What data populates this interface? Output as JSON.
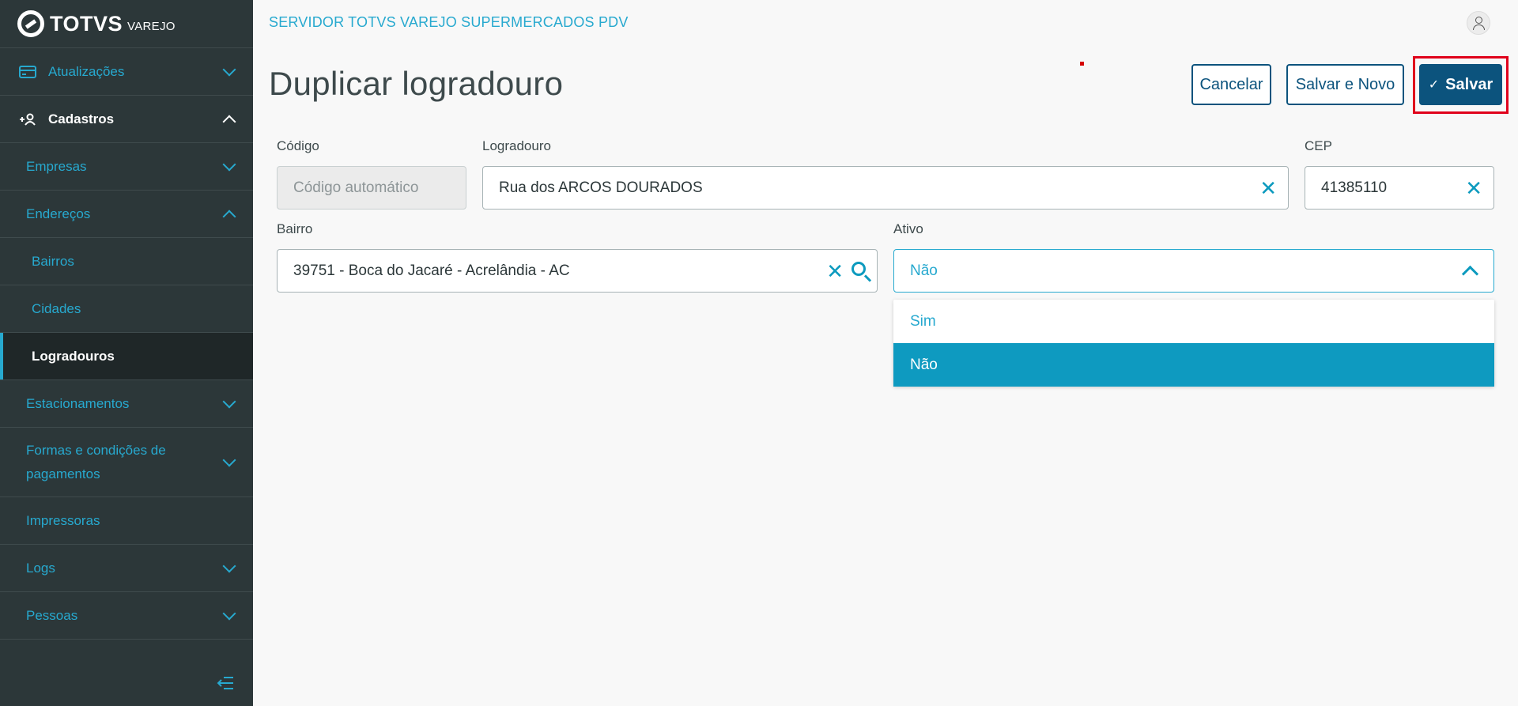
{
  "brand": {
    "name": "TOTVS",
    "sub": "VAREJO"
  },
  "header": {
    "title": "SERVIDOR TOTVS VAREJO SUPERMERCADOS PDV"
  },
  "page": {
    "title": "Duplicar logradouro"
  },
  "actions": {
    "cancel": "Cancelar",
    "save_new": "Salvar e Novo",
    "save": "Salvar"
  },
  "sidebar": {
    "items": [
      {
        "label": "Atualizações",
        "icon": "card-icon"
      },
      {
        "label": "Cadastros",
        "icon": "add-user-icon"
      },
      {
        "label": "Empresas"
      },
      {
        "label": "Endereços"
      },
      {
        "label": "Bairros"
      },
      {
        "label": "Cidades"
      },
      {
        "label": "Logradouros"
      },
      {
        "label": "Estacionamentos"
      },
      {
        "label": "Formas e condições de pagamentos"
      },
      {
        "label": "Impressoras"
      },
      {
        "label": "Logs"
      },
      {
        "label": "Pessoas"
      }
    ]
  },
  "form": {
    "codigo": {
      "label": "Código",
      "placeholder": "Código automático"
    },
    "logradouro": {
      "label": "Logradouro",
      "value": "Rua dos ARCOS DOURADOS"
    },
    "cep": {
      "label": "CEP",
      "value": "41385110"
    },
    "bairro": {
      "label": "Bairro",
      "value": "39751 - Boca do Jacaré - Acrelândia - AC"
    },
    "ativo": {
      "label": "Ativo",
      "value": "Não",
      "options": [
        "Sim",
        "Não"
      ]
    }
  },
  "colors": {
    "accent": "#27a9cf",
    "primary": "#0c537d",
    "sidebar": "#2c3739",
    "highlight": "#e0001b"
  }
}
